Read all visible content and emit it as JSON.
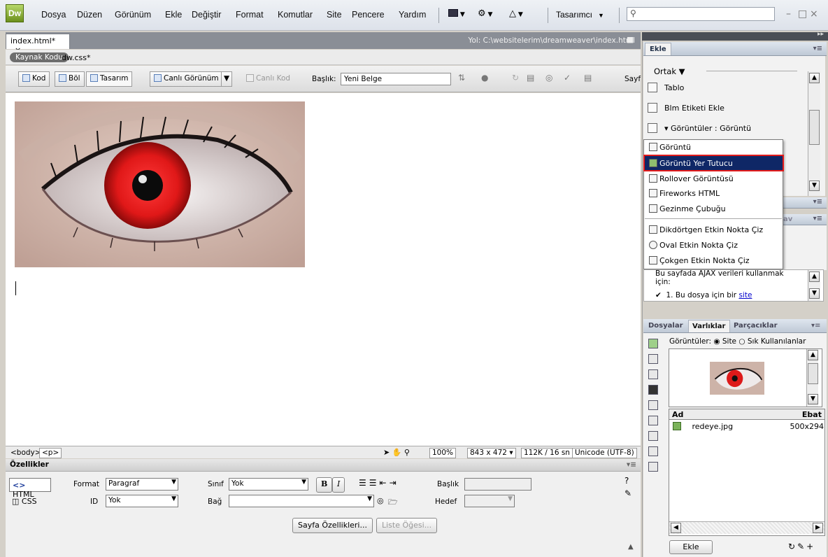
{
  "menubar": {
    "logo": "Dw",
    "items": [
      "Dosya",
      "Düzen",
      "Görünüm",
      "Ekle",
      "Değiştir",
      "Format",
      "Komutlar",
      "Site",
      "Pencere",
      "Yardım"
    ],
    "workspace": "Tasarımcı",
    "search_placeholder": "",
    "win_controls": [
      "–",
      "□",
      "×"
    ]
  },
  "document": {
    "tab_label": "index.html*",
    "tab_close": "×",
    "path": "Yol: C:\\websitelerim\\dreamweaver\\index.html",
    "related_source": "Kaynak Kodu",
    "related_css": "dw.css*"
  },
  "toolbar": {
    "code": "Kod",
    "split": "Böl",
    "design": "Tasarım",
    "live_view": "Canlı Görünüm",
    "live_code": "Canlı Kod",
    "title_label": "Başlık:",
    "title_value": "Yeni Belge",
    "more": "Sayf"
  },
  "status": {
    "tags": [
      "<body>",
      "<p>"
    ],
    "zoom": "100%",
    "window_size": "843 x 472",
    "download": "112K / 16 sn",
    "encoding": "Unicode (UTF-8)"
  },
  "properties": {
    "header": "Özellikler",
    "html_tab": "HTML",
    "css_tab": "CSS",
    "format_label": "Format",
    "format_value": "Paragraf",
    "class_label": "Sınıf",
    "class_value": "Yok",
    "id_label": "ID",
    "id_value": "Yok",
    "link_label": "Bağ",
    "link_value": "",
    "title_label": "Başlık",
    "target_label": "Hedef",
    "page_props": "Sayfa Özellikleri...",
    "list_item": "Liste Öğesi..."
  },
  "insert_panel": {
    "title": "Ekle",
    "category": "Ortak",
    "items": [
      "Tablo",
      "Blm Etiketi Ekle",
      "Görüntüler : Görüntü"
    ]
  },
  "dropdown": {
    "items": [
      "Görüntü",
      "Görüntü Yer Tutucu",
      "Rollover Görüntüsü",
      "Fireworks HTML",
      "Gezinme Çubuğu",
      "Dikdörtgen Etkin Nokta Çiz",
      "Oval Etkin Nokta Çiz",
      "Çokgen Etkin Nokta Çiz"
    ],
    "selected": "Görüntü Yer Tutucu"
  },
  "ajax_panel": {
    "text": "Bu sayfada AJAX verileri kullanmak için:",
    "step": "1. Bu dosya için bir",
    "step_link": "site"
  },
  "assets_panel": {
    "tabs": [
      "Dosyalar",
      "Varlıklar",
      "Parçacıklar"
    ],
    "active_tab": "Varlıklar",
    "images_label": "Görüntüler:",
    "radio_site": "Site",
    "radio_fav": "Sık Kullanılanlar",
    "col_name": "Ad",
    "col_size": "Ebat",
    "file_name": "redeye.jpg",
    "file_size": "500x294",
    "insert_btn": "Ekle"
  },
  "colors": {
    "selection": "#0f2766",
    "highlight_border": "#e31b1b",
    "iris": "#d81818"
  }
}
